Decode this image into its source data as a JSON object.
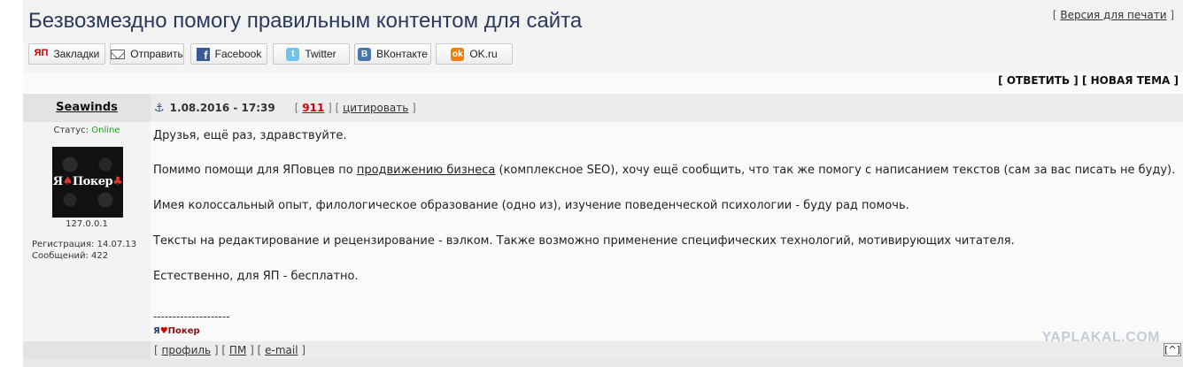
{
  "topic": {
    "title": "Безвозмездно помогу правильным контентом для сайта",
    "print_open": "[ ",
    "print_label": "Версия для печати",
    "print_close": " ]"
  },
  "share": {
    "buttons": [
      {
        "icon": "yap-icon",
        "icon_text": "ЯП",
        "label": "Закладки"
      },
      {
        "icon": "mail-icon",
        "icon_text": "",
        "label": "Отправить"
      },
      {
        "icon": "facebook-icon",
        "icon_text": "f",
        "label": "Facebook"
      },
      {
        "icon": "twitter-icon",
        "icon_text": "t",
        "label": "Twitter"
      },
      {
        "icon": "vk-icon",
        "icon_text": "B",
        "label": "ВКонтакте"
      },
      {
        "icon": "ok-icon",
        "icon_text": "ok",
        "label": "OK.ru"
      }
    ]
  },
  "actions": {
    "reply": "[ ОТВЕТИТЬ ]",
    "new_topic": "[ НОВАЯ ТЕМА ]"
  },
  "post": {
    "author": "Seawinds",
    "anchor_icon": "⚓",
    "date": "1.08.2016 - 17:39",
    "num_open": "[ ",
    "number": "911",
    "num_sep": " ] [ ",
    "quote": "цитировать",
    "quote_close": " ]",
    "status_label": "Статус: ",
    "status_value": "Online",
    "avatar_text_a": "Я",
    "avatar_suit_a": "♠",
    "avatar_text_b": "Покер",
    "avatar_suit_b": "♣",
    "ip": "127.0.0.1",
    "reg": "Регистрация: 14.07.13",
    "msgs": "Сообщений: 422",
    "p1": "Друзья, ещё раз, здравствуйте.",
    "p2_a": "Помимо помощи для ЯПовцев по ",
    "p2_link": "продвижению бизнеса",
    "p2_b": " (комплексное SEO), хочу ещё сообщить, что так же помогу с написанием текстов (сам за вас писать не буду).",
    "p3": "Имея колоссальный опыт, филологическое образование (одно из), изучение поведенческой психологии - буду рад помочь.",
    "p4": "Тексты на редактирование и рецензирование - вэлком. Также возможно применение специфических технологий, мотивирующих читателя.",
    "p5": "Естественно, для ЯП - бесплатно.",
    "sig_line": "--------------------",
    "sig_y": "Я",
    "sig_heart": "♥",
    "sig_poker": "Покер"
  },
  "footer": {
    "open1": "[ ",
    "profile": "профиль",
    "sep1": " ] [ ",
    "pm": "ПМ",
    "sep2": " ] [ ",
    "email": "e-mail",
    "close": " ]",
    "watermark": "YAPLAKAL.COM",
    "top": "[^]"
  }
}
